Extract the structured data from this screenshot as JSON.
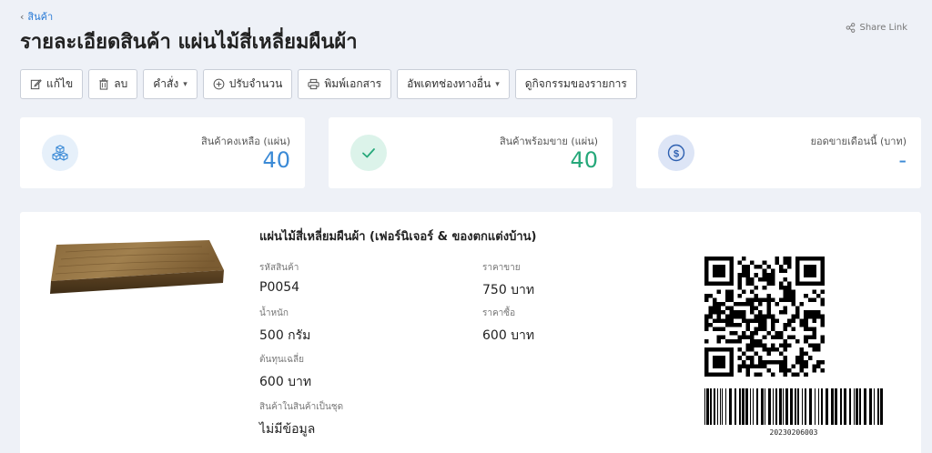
{
  "breadcrumb": {
    "parent": "สินค้า"
  },
  "page": {
    "title": "รายละเอียดสินค้า แผ่นไม้สี่เหลี่ยมผืนผ้า"
  },
  "header": {
    "share_label": "Share Link"
  },
  "toolbar": {
    "edit": "แก้ไข",
    "delete": "ลบ",
    "command": "คำสั่ง",
    "adjust_qty": "ปรับจำนวน",
    "print_doc": "พิมพ์เอกสาร",
    "update_channels": "อัพเดทช่องทางอื่น",
    "view_activity": "ดูกิจกรรมของรายการ"
  },
  "stats": {
    "remaining": {
      "label": "สินค้าคงเหลือ (แผ่น)",
      "value": "40",
      "color": "#3b8ad6",
      "icon": "boxes-icon"
    },
    "ready": {
      "label": "สินค้าพร้อมขาย (แผ่น)",
      "value": "40",
      "color": "#26a87a",
      "icon": "check-icon"
    },
    "monthly_sales": {
      "label": "ยอดขายเดือนนี้ (บาท)",
      "value": "-",
      "color": "#3b8ad6",
      "icon": "dollar-icon"
    }
  },
  "product": {
    "name": "แผ่นไม้สี่เหลี่ยมผืนผ้า (เฟอร์นิเจอร์ & ของตกแต่งบ้าน)",
    "sku_label": "รหัสสินค้า",
    "sku": "P0054",
    "weight_label": "น้ำหนัก",
    "weight": "500 กรัม",
    "avg_cost_label": "ต้นทุนเฉลี่ย",
    "avg_cost": "600 บาท",
    "bundle_label": "สินค้าในสินค้าเป็นชุด",
    "bundle": "ไม่มีข้อมูล",
    "sell_price_label": "ราคาขาย",
    "sell_price": "750 บาท",
    "buy_price_label": "ราคาซื้อ",
    "buy_price": "600 บาท",
    "barcode_number": "20230206003"
  }
}
